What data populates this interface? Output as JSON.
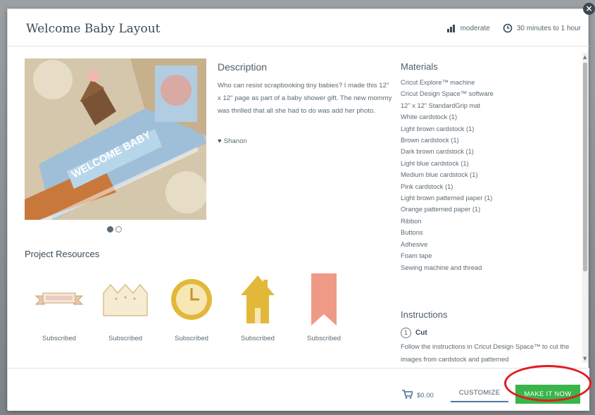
{
  "dialog": {
    "title": "Welcome Baby Layout",
    "difficulty": "moderate",
    "duration": "30 minutes to 1 hour"
  },
  "description": {
    "heading": "Description",
    "text": "Who can resist scrapbooking tiny babies? I made this 12\" x 12\" page as part of a baby shower gift. The new mommy was thrilled that all she had to do was add her photo.",
    "author": "Shanon"
  },
  "hero_image": {
    "caption": "WELCOME BABY",
    "slide_count": 2,
    "active_slide": 1
  },
  "resources": {
    "heading": "Project Resources",
    "items": [
      {
        "icon": "ribbon-banner-icon",
        "label": "Subscribed"
      },
      {
        "icon": "crown-tag-icon",
        "label": "Subscribed"
      },
      {
        "icon": "clock-icon",
        "label": "Subscribed"
      },
      {
        "icon": "house-icon",
        "label": "Subscribed"
      },
      {
        "icon": "pennant-banner-icon",
        "label": "Subscribed"
      }
    ]
  },
  "materials": {
    "heading": "Materials",
    "items": [
      "Cricut Explore™ machine",
      "Cricut Design Space™ software",
      "12\" x 12\" StandardGrip mat",
      "White cardstock (1)",
      "Light brown cardstock (1)",
      "Brown cardstock (1)",
      "Dark brown cardstock (1)",
      "Light blue cardstock (1)",
      "Medium blue cardstock (1)",
      "Pink cardstock (1)",
      "Light brown patterned paper (1)",
      "Orange patterned paper (1)",
      "Ribbon",
      "Buttons",
      "Adhesive",
      "Foam tape",
      "Sewing machine and thread"
    ]
  },
  "instructions": {
    "heading": "Instructions",
    "step_number": "1",
    "step_name": "Cut",
    "step_text": "Follow the instructions in Cricut Design Space™ to cut the images from cardstock and patterned"
  },
  "footer": {
    "price": "$0.00",
    "customize_label": "CUSTOMIZE",
    "make_label": "MAKE IT NOW"
  },
  "colors": {
    "make_button": "#39b54a",
    "customize_underline": "#4d7aa3",
    "resource_accent": "#e3b83a",
    "pennant": "#ef9a86",
    "annotation": "#e31b23"
  }
}
